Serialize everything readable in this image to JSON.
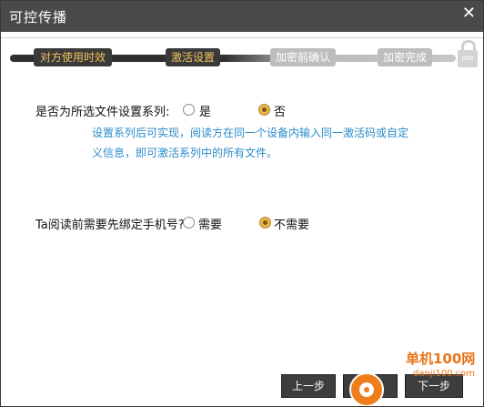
{
  "window": {
    "title": "可控传播",
    "close_label": "✕"
  },
  "steps": [
    {
      "label": "对方使用时效",
      "state": "active"
    },
    {
      "label": "激活设置",
      "state": "active"
    },
    {
      "label": "加密前确认",
      "state": "inactive"
    },
    {
      "label": "加密完成",
      "state": "inactive"
    }
  ],
  "lock": {
    "label": "pbb",
    "icon": "lock-icon"
  },
  "series_question": {
    "label": "是否为所选文件设置系列:",
    "options": [
      {
        "label": "是",
        "checked": false
      },
      {
        "label": "否",
        "checked": true
      }
    ],
    "info_line1": "设置系列后可实现，阅读方在同一个设备内输入同一激活码或自定",
    "info_line2": "义信息，即可激活系列中的所有文件。"
  },
  "phone_question": {
    "label": "Ta阅读前需要先绑定手机号?",
    "options": [
      {
        "label": "需要",
        "checked": false
      },
      {
        "label": "不需要",
        "checked": true
      }
    ]
  },
  "buttons": {
    "prev": "上一步",
    "skip": "跳过",
    "next": "下一步"
  },
  "watermark": {
    "line1": "单机100网",
    "line2": "danji100.com"
  },
  "colors": {
    "accent": "#f3c35a",
    "info_text": "#2a8bc9",
    "titlebar": "#4a4a4a"
  }
}
